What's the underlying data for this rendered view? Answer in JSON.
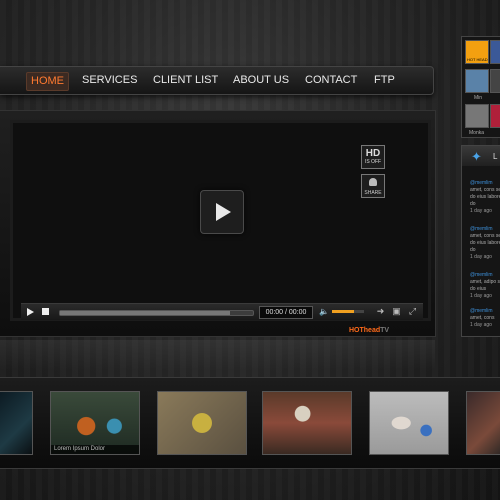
{
  "nav": {
    "items": [
      {
        "label": "HOME",
        "active": true
      },
      {
        "label": "SERVICES",
        "active": false
      },
      {
        "label": "CLIENT LIST",
        "active": false
      },
      {
        "label": "ABOUT US",
        "active": false
      },
      {
        "label": "CONTACT",
        "active": false
      },
      {
        "label": "FTP",
        "active": false
      }
    ]
  },
  "player": {
    "hd_label": "HD",
    "hd_sub": "IS OFF",
    "share_label": "SHARE",
    "time": "00:00 / 00:00",
    "progress": 0.88,
    "volume": 0.7,
    "brand_hot": "HOThead",
    "brand_tv": "TV"
  },
  "sidebar": {
    "social": {
      "brand_label": "HOT HEAD",
      "names": [
        "Min",
        "Monka"
      ]
    },
    "twitter": {
      "title": "L",
      "tweets": [
        {
          "user": "@memlim",
          "text": "amet, cons sed do eius labore et do",
          "ago": "1 day ago"
        },
        {
          "user": "@memlim",
          "text": "amet, cons sed do eius labore et do",
          "ago": "1 day ago"
        },
        {
          "user": "@memlim",
          "text": "amet, adipo sed do eius",
          "ago": "1 day ago"
        },
        {
          "user": "@memlim",
          "text": "amet, cons",
          "ago": "1 day ago"
        }
      ]
    }
  },
  "filmstrip": {
    "caption": "Lorem Ipsum Dolor"
  },
  "colors": {
    "accent": "#ff7a30",
    "link": "#3d8fd8",
    "volume": "#f0a020"
  }
}
